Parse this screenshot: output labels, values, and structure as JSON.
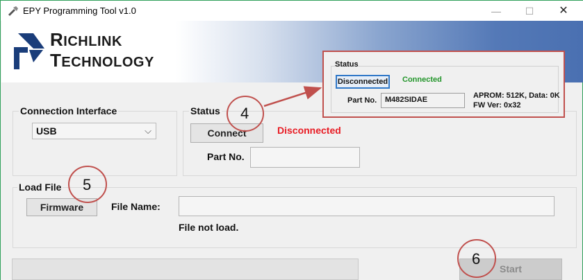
{
  "window": {
    "title": "EPY Programming Tool v1.0",
    "minimize_glyph": "—",
    "maximize_glyph": "☐",
    "close_glyph": "✕"
  },
  "banner": {
    "line1_big": "R",
    "line1_rest": "ICHLINK",
    "line2_big": "T",
    "line2_rest": "ECHNOLOGY"
  },
  "connection": {
    "legend": "Connection Interface",
    "selected": "USB",
    "arrow": "⌵"
  },
  "status": {
    "legend": "Status",
    "connect_label": "Connect",
    "state_text": "Disconnected",
    "part_label": "Part No.",
    "part_value": ""
  },
  "load_file": {
    "legend": "Load File",
    "firmware_label": "Firmware",
    "filename_label": "File Name:",
    "filename_value": "",
    "message": "File not load."
  },
  "actions": {
    "start_label": "Start",
    "progress": 0
  },
  "callout": {
    "status_label": "Status",
    "disconnected_label": "Disconnected",
    "connected_text": "Connected",
    "part_label": "Part No.",
    "part_value": "M482SIDAE",
    "info_line1": "APROM: 512K, Data: 0K",
    "info_line2": "FW Ver: 0x32"
  },
  "annotations": {
    "step4": "4",
    "step5": "5",
    "step6": "6"
  },
  "colors": {
    "frame": "#2fa05a",
    "status_red": "#e81b23",
    "status_green": "#22952a",
    "callout_border": "#c0504d"
  }
}
